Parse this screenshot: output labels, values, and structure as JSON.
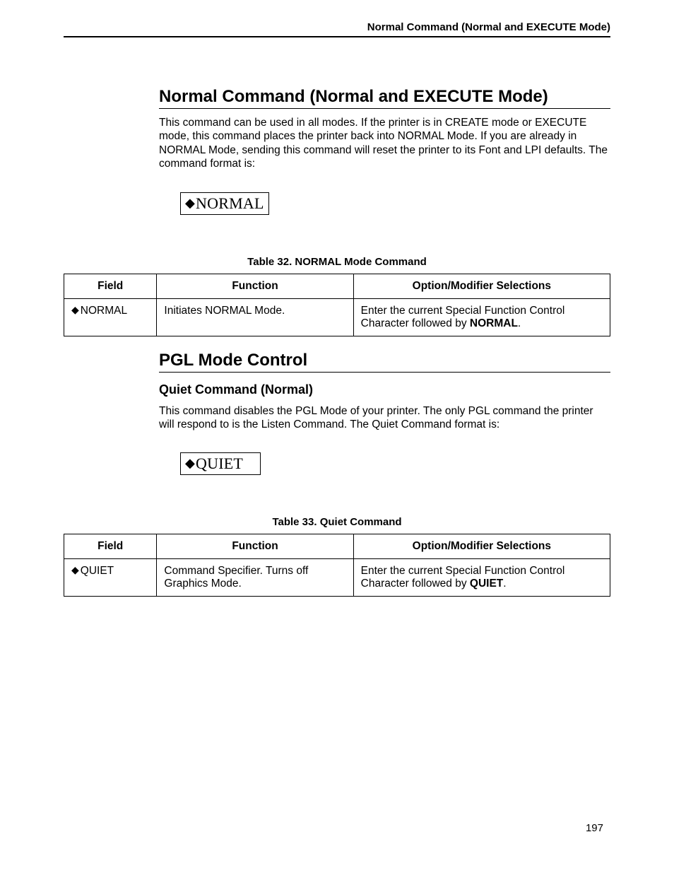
{
  "header": "Normal Command (Normal and EXECUTE Mode)",
  "section1": {
    "title": "Normal Command (Normal and EXECUTE Mode)",
    "para": "This command can be used in all modes. If the printer is in CREATE mode or EXECUTE mode, this command places the printer back into NORMAL Mode. If you are already in NORMAL Mode, sending this command will reset the printer to its Font and LPI defaults. The command format is:",
    "cmd": "NORMAL",
    "tableCaption": "Table 32. NORMAL Mode Command",
    "table": {
      "headers": [
        "Field",
        "Function",
        "Option/Modifier Selections"
      ],
      "row": {
        "field": "NORMAL",
        "func": "Initiates NORMAL Mode.",
        "optPrefix": "Enter the current Special Function Control Character followed by ",
        "optBold": "NORMAL",
        "optSuffix": "."
      }
    }
  },
  "section2": {
    "title": "PGL Mode Control",
    "subtitle": "Quiet Command (Normal)",
    "para": "This command disables the PGL Mode of your printer. The only PGL command the printer will respond to is the Listen Command. The Quiet Command format is:",
    "cmd": "QUIET",
    "tableCaption": "Table 33. Quiet Command",
    "table": {
      "headers": [
        "Field",
        "Function",
        "Option/Modifier Selections"
      ],
      "row": {
        "field": "QUIET",
        "func": "Command Specifier. Turns off Graphics Mode.",
        "optPrefix": "Enter the current Special Function Control Character followed by ",
        "optBold": "QUIET",
        "optSuffix": "."
      }
    }
  },
  "pageNumber": "197"
}
